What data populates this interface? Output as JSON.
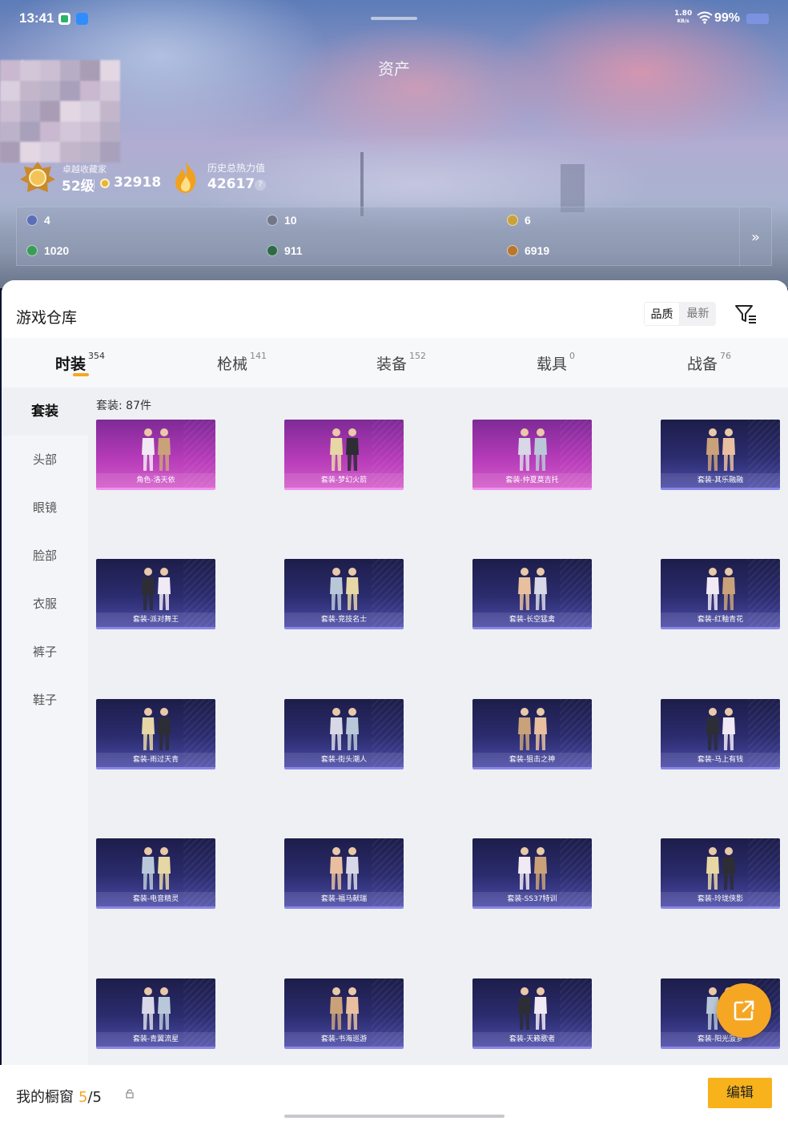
{
  "status_bar": {
    "time": "13:41",
    "speed_value": "1.80",
    "speed_unit": "KB/s",
    "battery": "99%"
  },
  "header": {
    "title": "资产"
  },
  "profile": {
    "rank_title": "卓越收藏家",
    "level": "52级",
    "coins": "32918",
    "heat_label": "历史总热力值",
    "heat_value": "42617",
    "help": "?"
  },
  "currencies": [
    {
      "value": "4",
      "icon": "card-icon",
      "color": "#5b6fb8"
    },
    {
      "value": "10",
      "icon": "gear-coin-icon",
      "color": "#6f7788"
    },
    {
      "value": "6",
      "icon": "gold-badge-icon",
      "color": "#c9a23a"
    },
    {
      "value": "1020",
      "icon": "green-gem-icon",
      "color": "#3d9b5a"
    },
    {
      "value": "911",
      "icon": "green-orb-icon",
      "color": "#2f6a48"
    },
    {
      "value": "6919",
      "icon": "bronze-coin-icon",
      "color": "#b7782e"
    }
  ],
  "warehouse": {
    "title": "游戏仓库",
    "sort_options": [
      "品质",
      "最新"
    ],
    "tabs": [
      {
        "label": "时装",
        "count": "354"
      },
      {
        "label": "枪械",
        "count": "141"
      },
      {
        "label": "装备",
        "count": "152"
      },
      {
        "label": "载具",
        "count": "0"
      },
      {
        "label": "战备",
        "count": "76"
      }
    ],
    "categories": [
      "套装",
      "头部",
      "眼镜",
      "脸部",
      "衣服",
      "裤子",
      "鞋子"
    ],
    "count_label": "套装: 87件",
    "items": [
      {
        "name": "角色-洛天依",
        "rarity": "pink"
      },
      {
        "name": "套装-梦幻火箭",
        "rarity": "pink"
      },
      {
        "name": "套装-仲夏莫吉托",
        "rarity": "pink"
      },
      {
        "name": "套装-其乐融融",
        "rarity": "blue"
      },
      {
        "name": "套装-派对舞王",
        "rarity": "blue"
      },
      {
        "name": "套装-竞技名士",
        "rarity": "blue"
      },
      {
        "name": "套装-长空猛禽",
        "rarity": "blue"
      },
      {
        "name": "套装-红釉青花",
        "rarity": "blue"
      },
      {
        "name": "套装-雨过天青",
        "rarity": "blue"
      },
      {
        "name": "套装-街头潮人",
        "rarity": "blue"
      },
      {
        "name": "套装-狙击之神",
        "rarity": "blue"
      },
      {
        "name": "套装-马上有钱",
        "rarity": "blue"
      },
      {
        "name": "套装-电音精灵",
        "rarity": "blue"
      },
      {
        "name": "套装-福马献瑞",
        "rarity": "blue"
      },
      {
        "name": "套装-SS37特训",
        "rarity": "blue"
      },
      {
        "name": "套装-玲珑侠影",
        "rarity": "blue"
      },
      {
        "name": "套装-青翼流星",
        "rarity": "blue"
      },
      {
        "name": "套装-书海巡游",
        "rarity": "blue"
      },
      {
        "name": "套装-天籁歌者",
        "rarity": "blue"
      },
      {
        "name": "套装-阳光菠萝",
        "rarity": "blue"
      }
    ]
  },
  "showcase": {
    "label": "我的橱窗",
    "current": "5",
    "total": "/5",
    "edit_label": "编辑"
  }
}
